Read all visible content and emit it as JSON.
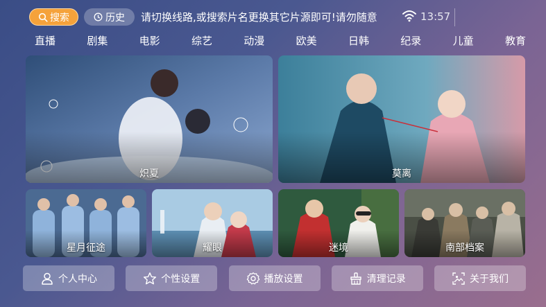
{
  "header": {
    "search_label": "搜索",
    "history_label": "历史",
    "notice": "请切换线路,或搜索片名更换其它片源即可!请勿随意",
    "time": "13:57"
  },
  "nav": [
    "直播",
    "剧集",
    "电影",
    "综艺",
    "动漫",
    "欧美",
    "日韩",
    "纪录",
    "儿童",
    "教育"
  ],
  "cards": [
    {
      "title": "炽夏"
    },
    {
      "title": "莫离"
    },
    {
      "title": "星月征途"
    },
    {
      "title": "耀眼"
    },
    {
      "title": "迷境"
    },
    {
      "title": "南部档案"
    }
  ],
  "bottom_buttons": [
    {
      "label": "个人中心",
      "icon": "user-icon"
    },
    {
      "label": "个性设置",
      "icon": "star-icon"
    },
    {
      "label": "播放设置",
      "icon": "gear-icon"
    },
    {
      "label": "清理记录",
      "icon": "broom-icon"
    },
    {
      "label": "关于我们",
      "icon": "image-icon"
    }
  ],
  "colors": {
    "search_accent": "#f5a23b"
  }
}
